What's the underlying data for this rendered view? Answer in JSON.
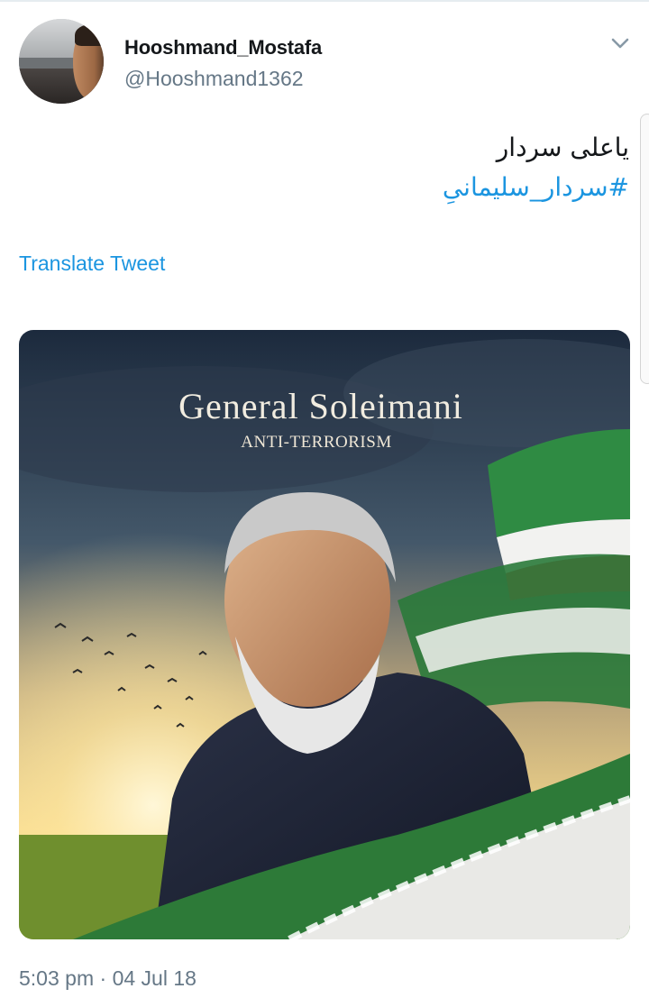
{
  "user": {
    "display_name": "Hooshmand_Mostafa",
    "handle": "@Hooshmand1362"
  },
  "tweet": {
    "text": "یاعلی سردار",
    "hashtag": "#سردار_سلیمانیِ",
    "translate_label": "Translate Tweet",
    "image": {
      "title": "General Soleimani",
      "subtitle": "ANTI-TERRORISM"
    },
    "time": "5:03 pm",
    "separator": "·",
    "date": "04 Jul 18"
  },
  "icons": {
    "menu_caret": "chevron-down-icon"
  },
  "colors": {
    "link": "#1b95e0",
    "secondary_text": "#657786",
    "primary_text": "#14171a"
  }
}
